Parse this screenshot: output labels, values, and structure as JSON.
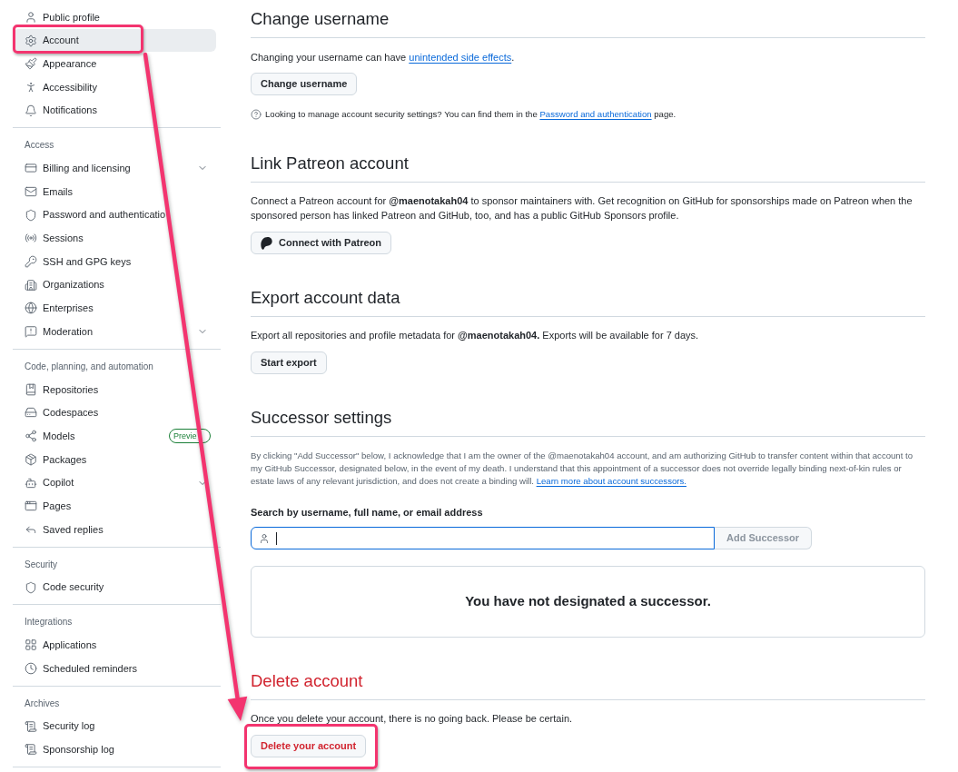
{
  "sidebar": {
    "sections": [
      {
        "items": [
          {
            "label": "Public profile",
            "kind": "link",
            "selected": false
          },
          {
            "label": "Account",
            "kind": "link",
            "selected": true
          },
          {
            "label": "Appearance",
            "kind": "link",
            "selected": false
          },
          {
            "label": "Accessibility",
            "kind": "link",
            "selected": false
          },
          {
            "label": "Notifications",
            "kind": "link",
            "selected": false
          }
        ]
      },
      {
        "heading": "Access",
        "items": [
          {
            "label": "Billing and licensing",
            "kind": "menu",
            "expanded": false,
            "selected": false
          },
          {
            "label": "Emails",
            "kind": "link",
            "selected": false
          },
          {
            "label": "Password and authenticatio",
            "kind": "link",
            "selected": false
          },
          {
            "label": "Sessions",
            "kind": "link",
            "selected": false
          },
          {
            "label": "SSH and GPG keys",
            "kind": "link",
            "selected": false
          },
          {
            "label": "Organizations",
            "kind": "link",
            "selected": false
          },
          {
            "label": "Enterprises",
            "kind": "link",
            "selected": false
          },
          {
            "label": "Moderation",
            "kind": "menu",
            "expanded": false,
            "selected": false
          }
        ]
      },
      {
        "heading": "Code, planning, and automation",
        "items": [
          {
            "label": "Repositories",
            "kind": "link",
            "selected": false
          },
          {
            "label": "Codespaces",
            "kind": "link",
            "selected": false
          },
          {
            "label": "Models",
            "kind": "link",
            "selected": false,
            "badge": "Previe"
          },
          {
            "label": "Packages",
            "kind": "link",
            "selected": false
          },
          {
            "label": "Copilot",
            "kind": "menu",
            "expanded": false,
            "selected": false
          },
          {
            "label": "Pages",
            "kind": "link",
            "selected": false
          },
          {
            "label": "Saved replies",
            "kind": "link",
            "selected": false
          }
        ]
      },
      {
        "heading": "Security",
        "items": [
          {
            "label": "Code security",
            "kind": "link",
            "selected": false
          }
        ]
      },
      {
        "heading": "Integrations",
        "items": [
          {
            "label": "Applications",
            "kind": "link",
            "selected": false
          },
          {
            "label": "Scheduled reminders",
            "kind": "link",
            "selected": false
          }
        ]
      },
      {
        "heading": "Archives",
        "items": [
          {
            "label": "Security log",
            "kind": "link",
            "selected": false
          },
          {
            "label": "Sponsorship log",
            "kind": "link",
            "selected": false
          }
        ]
      }
    ]
  },
  "change_username": {
    "title": "Change username",
    "text": "Changing your username can have ",
    "link": "unintended side effects",
    "text_after": ".",
    "button": "Change username",
    "note": "Looking to manage account security settings? You can find them in the ",
    "note_link": "Password and authentication",
    "note_after": " page."
  },
  "link_patreon": {
    "title": "Link Patreon account",
    "text": "Connect a Patreon account for **@maenotakah04** to sponsor maintainers with. Get recognition on GitHub for sponsorships made on Patreon when the sponsored person has linked Patreon and GitHub, too, and has a public GitHub Sponsors profile.",
    "button": "Connect with Patreon"
  },
  "export_data": {
    "title": "Export account data",
    "text": "Export all repositories and profile metadata for **@maenotakah04.** Exports will be available for 7 days.",
    "button": "Start export"
  },
  "successor": {
    "title": "Successor settings",
    "text": "By clicking \"Add Successor\" below, I acknowledge that I am the owner of the @maenotakah04 account, and am authorizing GitHub to transfer content within that account to my GitHub Successor, designated below, in the event of my death. I understand that this appointment of a successor does not override legally binding next-of-kin rules or estate laws of any relevant jurisdiction, and does not create a binding will. ",
    "link": "Learn more about account successors.",
    "search_label": "Search by username, full name, or email address",
    "search": {
      "focused": true
    },
    "add_button": {
      "label": "Add Successor",
      "disabled": true
    },
    "empty_message": "You have not designated a successor."
  },
  "delete_account": {
    "title": "Delete account",
    "text": "Once you delete your account, there is no going back. Please be certain.",
    "button": "Delete your account"
  }
}
